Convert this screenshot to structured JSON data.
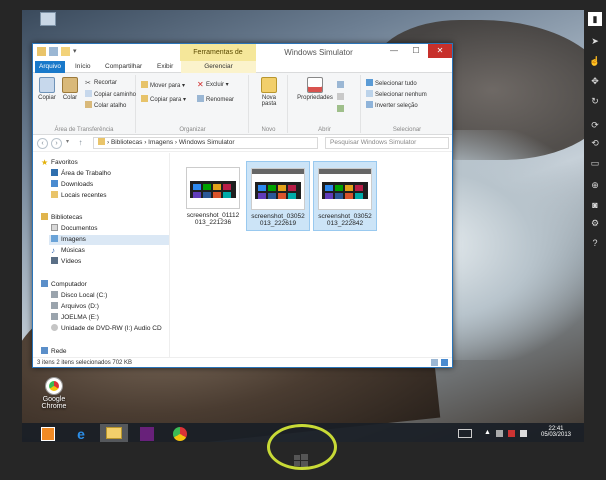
{
  "window": {
    "title": "Windows Simulator",
    "context_tab_header": "Ferramentas de Imagem",
    "controls": {
      "minimize": "—",
      "maximize": "☐",
      "close": "✕"
    }
  },
  "tabs": [
    "Arquivo",
    "Início",
    "Compartilhar",
    "Exibir",
    "Gerenciar"
  ],
  "ribbon": {
    "clipboard": {
      "copy": "Copiar",
      "paste": "Colar",
      "cut": "Recortar",
      "copy_path": "Copiar caminho",
      "paste_shortcut": "Colar atalho",
      "group": "Área de Transferência"
    },
    "organize": {
      "move_to": "Mover para ▾",
      "copy_to": "Copiar para ▾",
      "delete": "Excluir ▾",
      "rename": "Renomear",
      "group": "Organizar"
    },
    "new": {
      "new_folder_line1": "Nova",
      "new_folder_line2": "pasta",
      "group": "Novo"
    },
    "open": {
      "properties": "Propriedades",
      "group": "Abrir"
    },
    "select": {
      "select_all": "Selecionar tudo",
      "select_none": "Selecionar nenhum",
      "invert": "Inverter seleção",
      "group": "Selecionar"
    }
  },
  "address": {
    "path": "› Bibliotecas › Imagens › Windows Simulator",
    "search_placeholder": "Pesquisar Windows Simulator"
  },
  "nav": {
    "favorites": "Favoritos",
    "desktop": "Área de Trabalho",
    "downloads": "Downloads",
    "recent": "Locais recentes",
    "libraries": "Bibliotecas",
    "documents": "Documentos",
    "pictures": "Imagens",
    "music": "Músicas",
    "videos": "Vídeos",
    "computer": "Computador",
    "local_disk": "Disco Local (C:)",
    "files_disk": "Arquivos (D:)",
    "joelma": "JOELMA (E:)",
    "dvd": "Unidade de DVD-RW (I:) Audio CD",
    "network": "Rede"
  },
  "files": [
    {
      "line1": "screenshot_01112",
      "line2": "013_221236",
      "selected": false
    },
    {
      "line1": "screenshot_03052",
      "line2": "013_222619",
      "selected": true
    },
    {
      "line1": "screenshot_03052",
      "line2": "013_222842",
      "selected": true
    }
  ],
  "status": "3 itens      2 itens selecionados  702 KB",
  "desktop": {
    "chrome_label": "Google Chrome"
  },
  "tray": {
    "time": "22:41",
    "date": "05/03/2013"
  },
  "colors": {
    "accent": "#1979ca",
    "context_tab": "#f5e79a",
    "highlight_circle": "#c8da36"
  }
}
